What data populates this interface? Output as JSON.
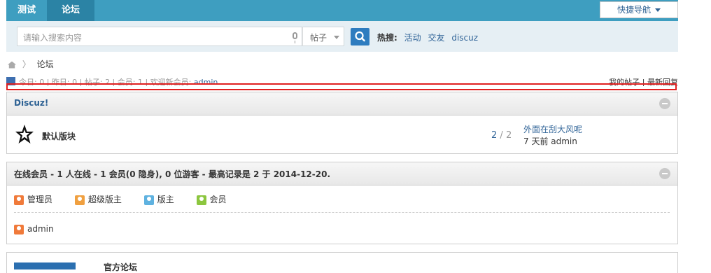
{
  "topnav": {
    "tabs": [
      {
        "label": "测试"
      },
      {
        "label": "论坛"
      }
    ],
    "quick_nav": "快捷导航"
  },
  "search": {
    "placeholder": "请输入搜索内容",
    "type": "帖子",
    "hot_label": "热搜:",
    "hot_terms": [
      "活动",
      "交友",
      "discuz"
    ]
  },
  "breadcrumb": {
    "current": "论坛"
  },
  "stats": {
    "today_label": "今日:",
    "today": "0",
    "yesterday_label": "昨日:",
    "yesterday": "0",
    "posts_label": "帖子:",
    "posts": "2",
    "members_label": "会员:",
    "members": "1",
    "welcome_label": "欢迎新会员:",
    "newest_member": "admin",
    "my_posts": "我的帖子",
    "latest_replies": "最新回复"
  },
  "category": {
    "title": "Discuz!",
    "forums": [
      {
        "name": "默认版块",
        "threads": "2",
        "posts": "2",
        "last_post_title": "外面在刮大风呢",
        "last_post_meta": "7 天前 admin"
      }
    ]
  },
  "online": {
    "title": "在线会员 - 1 人在线 - 1 会员(0 隐身), 0 位游客 - 最高记录是 2 于 2014-12-20.",
    "legend": [
      {
        "label": "管理员",
        "color": "#f07a3a"
      },
      {
        "label": "超级版主",
        "color": "#f0a040"
      },
      {
        "label": "版主",
        "color": "#5fb2e0"
      },
      {
        "label": "会员",
        "color": "#8cc63f"
      }
    ],
    "members": [
      {
        "name": "admin",
        "color": "#f07a3a"
      }
    ]
  },
  "next_section": {
    "title": "官方论坛"
  },
  "colors": {
    "nav": "#3e9ec0",
    "nav_active": "#2b83a5",
    "link": "#336699",
    "highlight_box": "#e02020"
  }
}
